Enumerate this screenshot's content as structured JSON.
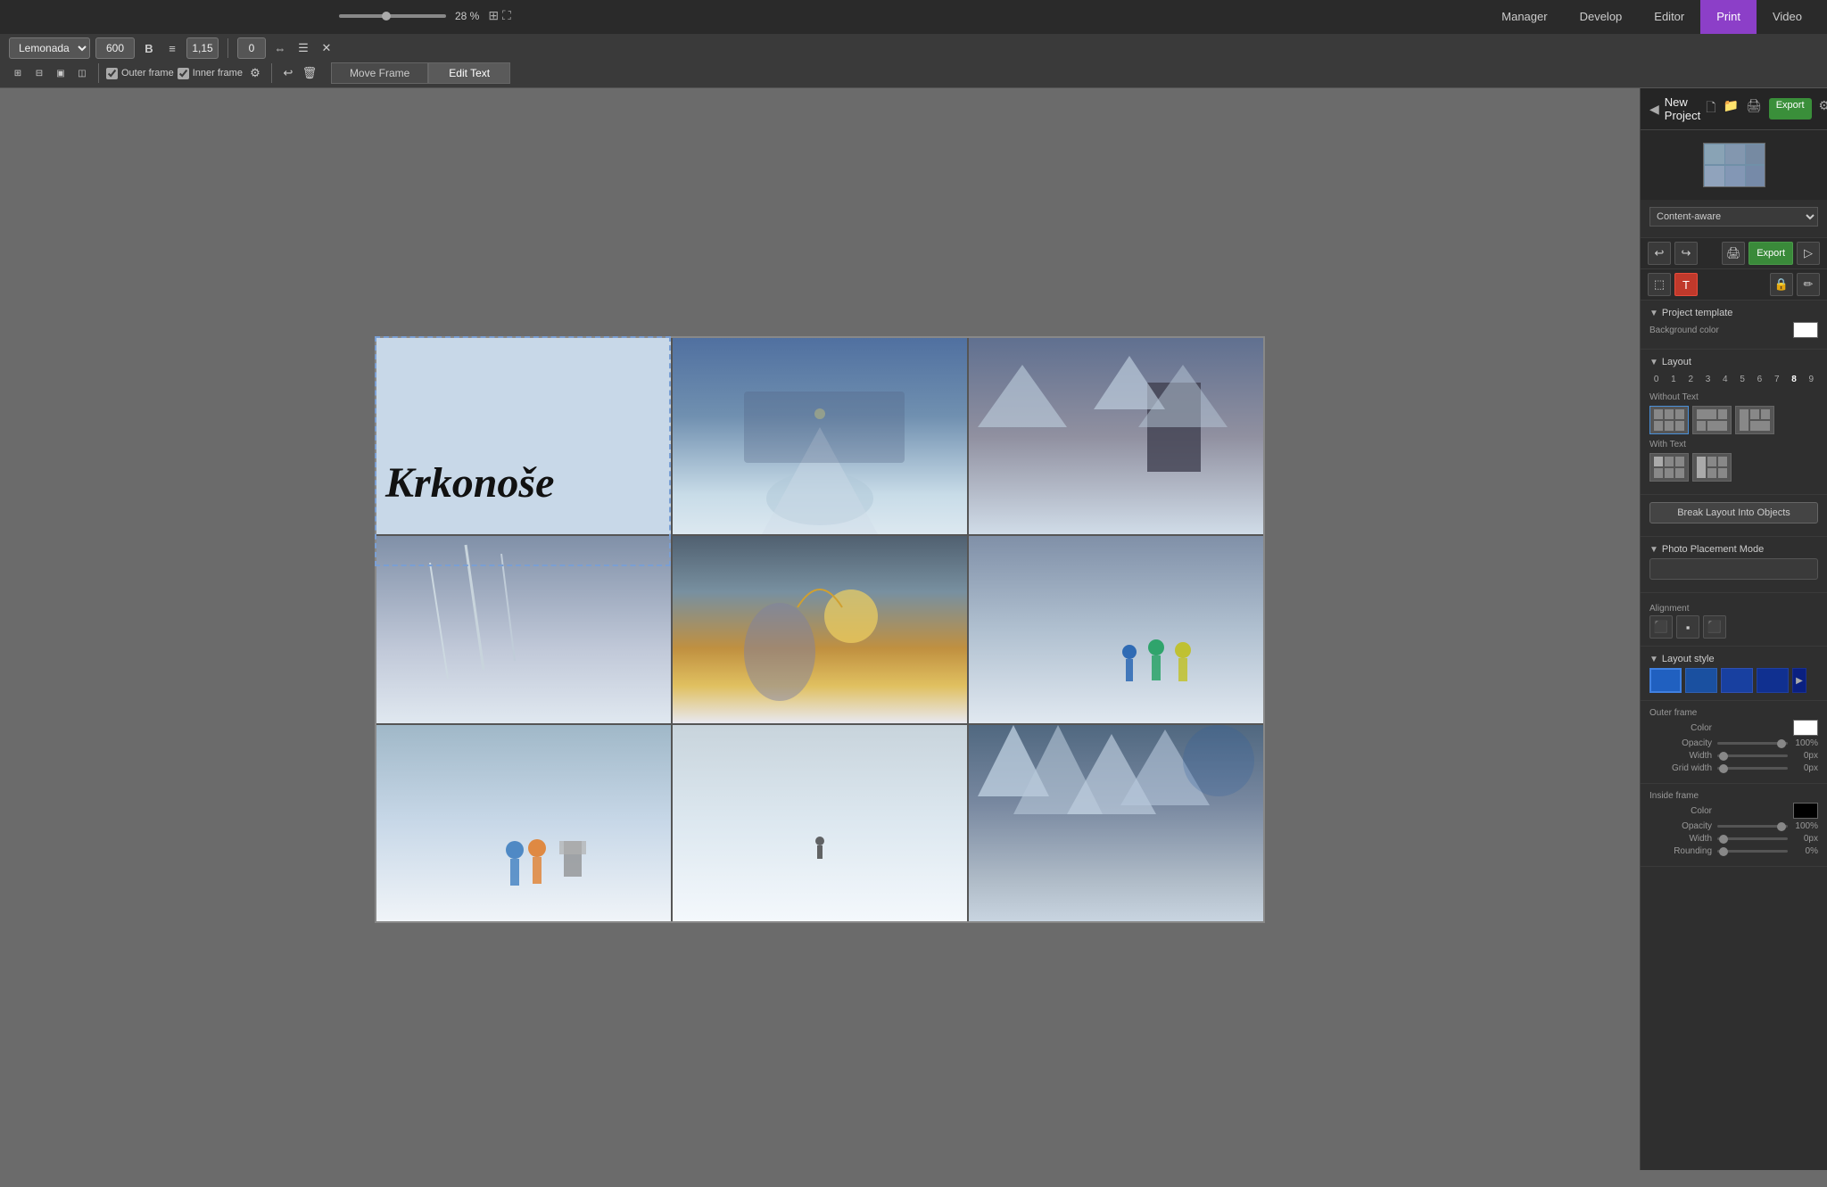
{
  "topnav": {
    "items": [
      "Manager",
      "Develop",
      "Editor",
      "Print",
      "Video"
    ],
    "active": "Print"
  },
  "zoom": {
    "value": "28 %"
  },
  "toolbar": {
    "font": "Lemonada",
    "size": "600",
    "weight": "B",
    "size2": "1,15",
    "rotation": "0",
    "outer_frame": "Outer frame",
    "inner_frame": "Inner frame",
    "move_frame": "Move Frame",
    "edit_text": "Edit Text"
  },
  "canvas": {
    "title": "Krkonoše",
    "selection_label": "text frame selection"
  },
  "right_panel": {
    "new_project": "New Project",
    "content_aware": "Content-aware",
    "export_btn": "Export",
    "project_template": "Project template",
    "background_color_label": "Background color",
    "layout_label": "Layout",
    "layout_numbers": [
      "0",
      "1",
      "2",
      "3",
      "4",
      "5",
      "6",
      "7",
      "8",
      "9"
    ],
    "without_text_label": "Without Text",
    "with_text_label": "With Text",
    "break_layout_btn": "Break Layout Into Objects",
    "photo_placement_label": "Photo Placement Mode",
    "alignment_label": "Alignment",
    "layout_style_label": "Layout style",
    "outer_frame_label": "Outer frame",
    "inside_frame_label": "Inside frame",
    "color_label": "Color",
    "opacity_label": "Opacity",
    "opacity_val": "100%",
    "width_label": "Width",
    "width_val": "0px",
    "grid_width_label": "Grid width",
    "grid_width_val": "0px",
    "rounding_label": "Rounding",
    "rounding_val": "0%",
    "inside_color": "#000000",
    "outside_color": "#ffffff"
  }
}
